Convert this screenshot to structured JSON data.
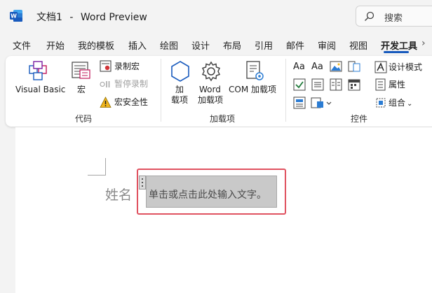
{
  "titlebar": {
    "doc_name": "文档1",
    "separator": "-",
    "app_name": "Word Preview",
    "search_label": "搜索"
  },
  "menu": {
    "tabs": [
      {
        "label": "文件"
      },
      {
        "label": "开始"
      },
      {
        "label": "我的模板"
      },
      {
        "label": "插入"
      },
      {
        "label": "绘图"
      },
      {
        "label": "设计"
      },
      {
        "label": "布局"
      },
      {
        "label": "引用"
      },
      {
        "label": "邮件"
      },
      {
        "label": "审阅"
      },
      {
        "label": "视图"
      },
      {
        "label": "开发工具",
        "active": true
      }
    ]
  },
  "ribbon": {
    "code": {
      "group_label": "代码",
      "visual_basic": "Visual Basic",
      "macros": "宏",
      "record_macro": "录制宏",
      "pause_recording": "暂停录制",
      "macro_security": "宏安全性"
    },
    "addins": {
      "group_label": "加载项",
      "addins_line1": "加",
      "addins_line2": "载项",
      "word_addins_line1": "Word",
      "word_addins_line2": "加载项",
      "com_addins": "COM 加载项"
    },
    "controls": {
      "group_label": "控件",
      "design_mode": "设计模式",
      "properties": "属性",
      "group": "组合"
    }
  },
  "document": {
    "field_label": "姓名",
    "placeholder": "单击或点击此处输入文字。"
  },
  "colors": {
    "accent": "#185abd",
    "control_border": "#e05260",
    "placeholder_bg": "#c9c9c9"
  }
}
